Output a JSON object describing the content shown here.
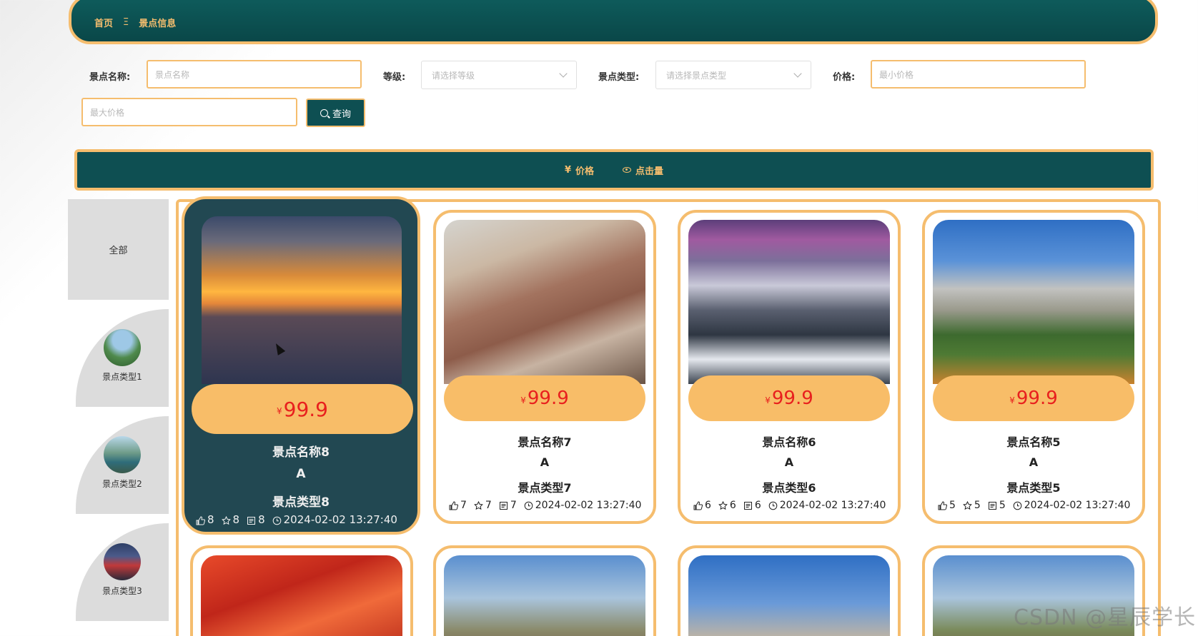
{
  "breadcrumb": {
    "home": "首页",
    "separator": "Ξ",
    "current": "景点信息"
  },
  "search": {
    "name_label": "景点名称:",
    "name_placeholder": "景点名称",
    "level_label": "等级:",
    "level_placeholder": "请选择等级",
    "type_label": "景点类型:",
    "type_placeholder": "请选择景点类型",
    "price_label": "价格:",
    "min_price_placeholder": "最小价格",
    "max_price_placeholder": "最大价格",
    "search_button": "查询"
  },
  "sort": {
    "price": "价格",
    "price_icon": "¥",
    "views": "点击量"
  },
  "sidebar": {
    "all": "全部",
    "categories": [
      {
        "label": "景点类型1"
      },
      {
        "label": "景点类型2"
      },
      {
        "label": "景点类型3"
      }
    ]
  },
  "cards": [
    {
      "currency": "¥",
      "price": "99.9",
      "name": "景点名称8",
      "level": "A",
      "type": "景点类型8",
      "likes": "8",
      "favorites": "8",
      "comments": "8",
      "time": "2024-02-02 13:27:40"
    },
    {
      "currency": "¥",
      "price": "99.9",
      "name": "景点名称7",
      "level": "A",
      "type": "景点类型7",
      "likes": "7",
      "favorites": "7",
      "comments": "7",
      "time": "2024-02-02 13:27:40"
    },
    {
      "currency": "¥",
      "price": "99.9",
      "name": "景点名称6",
      "level": "A",
      "type": "景点类型6",
      "likes": "6",
      "favorites": "6",
      "comments": "6",
      "time": "2024-02-02 13:27:40"
    },
    {
      "currency": "¥",
      "price": "99.9",
      "name": "景点名称5",
      "level": "A",
      "type": "景点类型5",
      "likes": "5",
      "favorites": "5",
      "comments": "5",
      "time": "2024-02-02 13:27:40"
    }
  ],
  "watermark": "CSDN @星辰学长",
  "colors": {
    "accent": "#f5bd6e",
    "primary": "#0e4f52",
    "price": "#e8201e"
  }
}
